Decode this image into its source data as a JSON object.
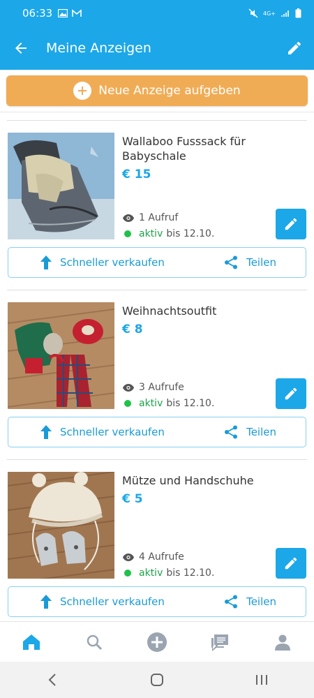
{
  "status_bar": {
    "time": "06:33",
    "network": "4G+",
    "colors": {
      "bg": "#1ca7e8"
    }
  },
  "app_bar": {
    "title": "Meine Anzeigen",
    "back_icon": "arrow-left-icon",
    "edit_icon": "pencil-icon"
  },
  "new_ad_button": {
    "label": "Neue Anzeige aufgeben",
    "color": "#f0ac55"
  },
  "listings": [
    {
      "title": "Wallaboo Fusssack für Babyschale",
      "price": "€ 15",
      "views": "1 Aufruf",
      "status": "aktiv",
      "until": "bis 12.10.",
      "sell_label": "Schneller verkaufen",
      "share_label": "Teilen"
    },
    {
      "title": "Weihnachtsoutfit",
      "price": "€ 8",
      "views": "3 Aufrufe",
      "status": "aktiv",
      "until": "bis 12.10.",
      "sell_label": "Schneller verkaufen",
      "share_label": "Teilen"
    },
    {
      "title": "Mütze und Handschuhe",
      "price": "€ 5",
      "views": "4 Aufrufe",
      "status": "aktiv",
      "until": "bis 12.10.",
      "sell_label": "Schneller verkaufen",
      "share_label": "Teilen"
    }
  ],
  "bottom_nav": {
    "items": [
      "home-icon",
      "search-icon",
      "add-circle-icon",
      "messages-icon",
      "profile-icon"
    ],
    "active": "home-icon"
  },
  "colors": {
    "accent": "#1ca7e8",
    "price": "#1ca7e8",
    "status_active": "#1ec24a"
  }
}
